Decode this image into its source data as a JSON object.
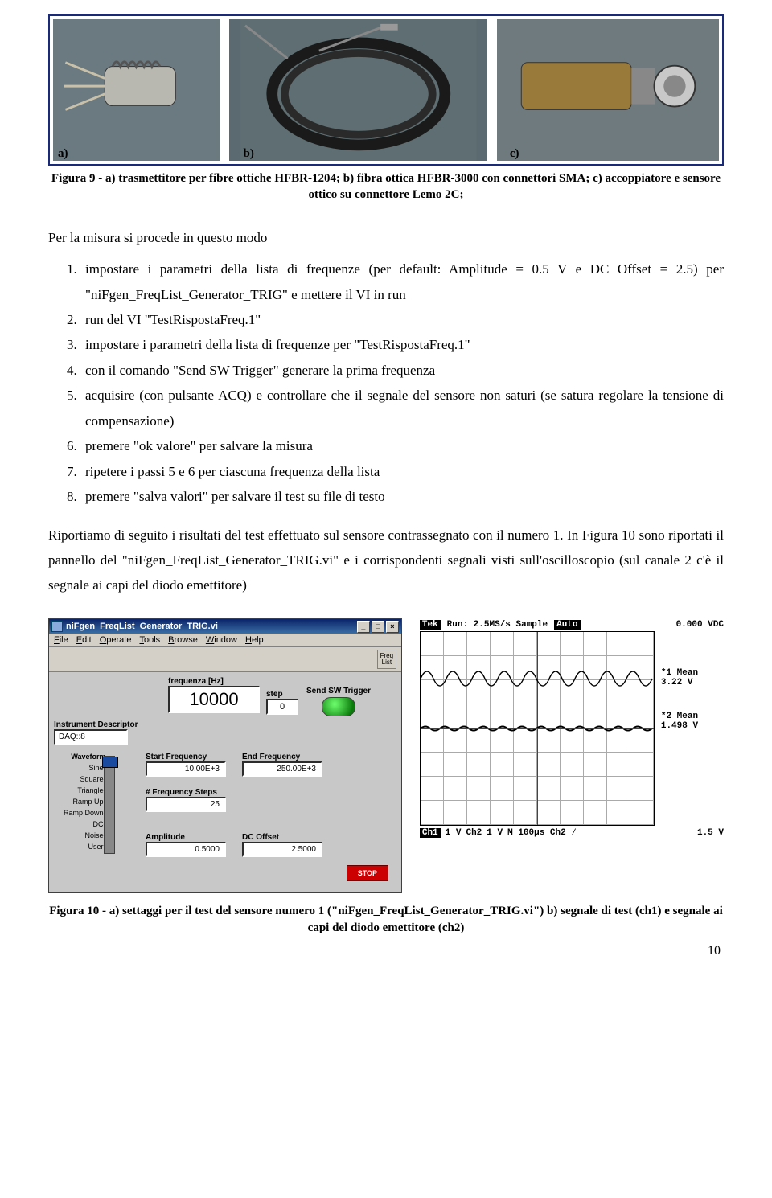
{
  "figure9": {
    "labels": {
      "a": "a)",
      "b": "b)",
      "c": "c)"
    },
    "caption": "Figura 9 - a) trasmettitore per fibre ottiche HFBR-1204; b) fibra ottica HFBR-3000 con connettori SMA; c) accoppiatore e sensore ottico su connettore Lemo 2C;"
  },
  "intro": "Per la misura si procede in questo modo",
  "steps": [
    "impostare i parametri della lista di frequenze (per default: Amplitude = 0.5 V e DC  Offset = 2.5) per \"niFgen_FreqList_Generator_TRIG\" e mettere il VI in run",
    "run del VI  \"TestRispostaFreq.1\"",
    "impostare i parametri della lista di frequenze per \"TestRispostaFreq.1\"",
    "con il comando \"Send SW Trigger\" generare la prima frequenza",
    "acquisire (con pulsante ACQ) e controllare che il segnale del sensore non saturi (se satura regolare la tensione di compensazione)",
    "premere \"ok valore\" per salvare la misura",
    "ripetere i passi 5 e 6 per ciascuna frequenza della lista",
    "premere \"salva valori\" per salvare il test su file di testo"
  ],
  "paragraph": "Riportiamo di seguito i risultati del test effettuato sul sensore contrassegnato con il numero 1. In Figura 10 sono riportati il pannello del  \"niFgen_FreqList_Generator_TRIG.vi\" e i corrispondenti segnali visti sull'oscilloscopio (sul canale 2 c'è il segnale ai capi del diodo emettitore)",
  "window": {
    "title": "niFgen_FreqList_Generator_TRIG.vi",
    "menu": [
      "File",
      "Edit",
      "Operate",
      "Tools",
      "Browse",
      "Window",
      "Help"
    ],
    "toolbtn": "Freq List",
    "freq_label": "frequenza [Hz]",
    "freq_value": "10000",
    "step_label": "step",
    "step_value": "0",
    "trigger_label": "Send SW Trigger",
    "instr_label": "Instrument Descriptor",
    "instr_value": "DAQ::8",
    "waveform_label": "Waveform",
    "waveforms": [
      "Sine-",
      "Square-",
      "Triangle-",
      "Ramp Up-",
      "Ramp Down-",
      "DC-",
      "Noise-",
      "User-"
    ],
    "startf_label": "Start Frequency",
    "startf_value": "10.00E+3",
    "endf_label": "End Frequency",
    "endf_value": "250.00E+3",
    "nsteps_label": "# Frequency Steps",
    "nsteps_value": "25",
    "amp_label": "Amplitude",
    "amp_value": "0.5000",
    "dco_label": "DC Offset",
    "dco_value": "2.5000",
    "stop": "STOP"
  },
  "scope": {
    "brand": "Tek",
    "run": "Run: 2.5MS/s  Sample",
    "auto": "Auto",
    "vdc": "0.000 VDC",
    "m1_label": "*1 Mean",
    "m1_value": "3.22 V",
    "m2_label": "*2 Mean",
    "m2_value": "1.498 V",
    "bottom": {
      "ch1": "Ch1",
      "ch1v": "1 V",
      "ch2": "Ch2",
      "ch2v": "1 V",
      "m": "M 100µs Ch2 ⁄",
      "trig": "1.5 V"
    }
  },
  "figure10_caption": "Figura 10 - a) settaggi per il test del sensore numero 1 (\"niFgen_FreqList_Generator_TRIG.vi\") b) segnale di test (ch1) e segnale ai capi del diodo emettitore (ch2)",
  "page_number": "10"
}
